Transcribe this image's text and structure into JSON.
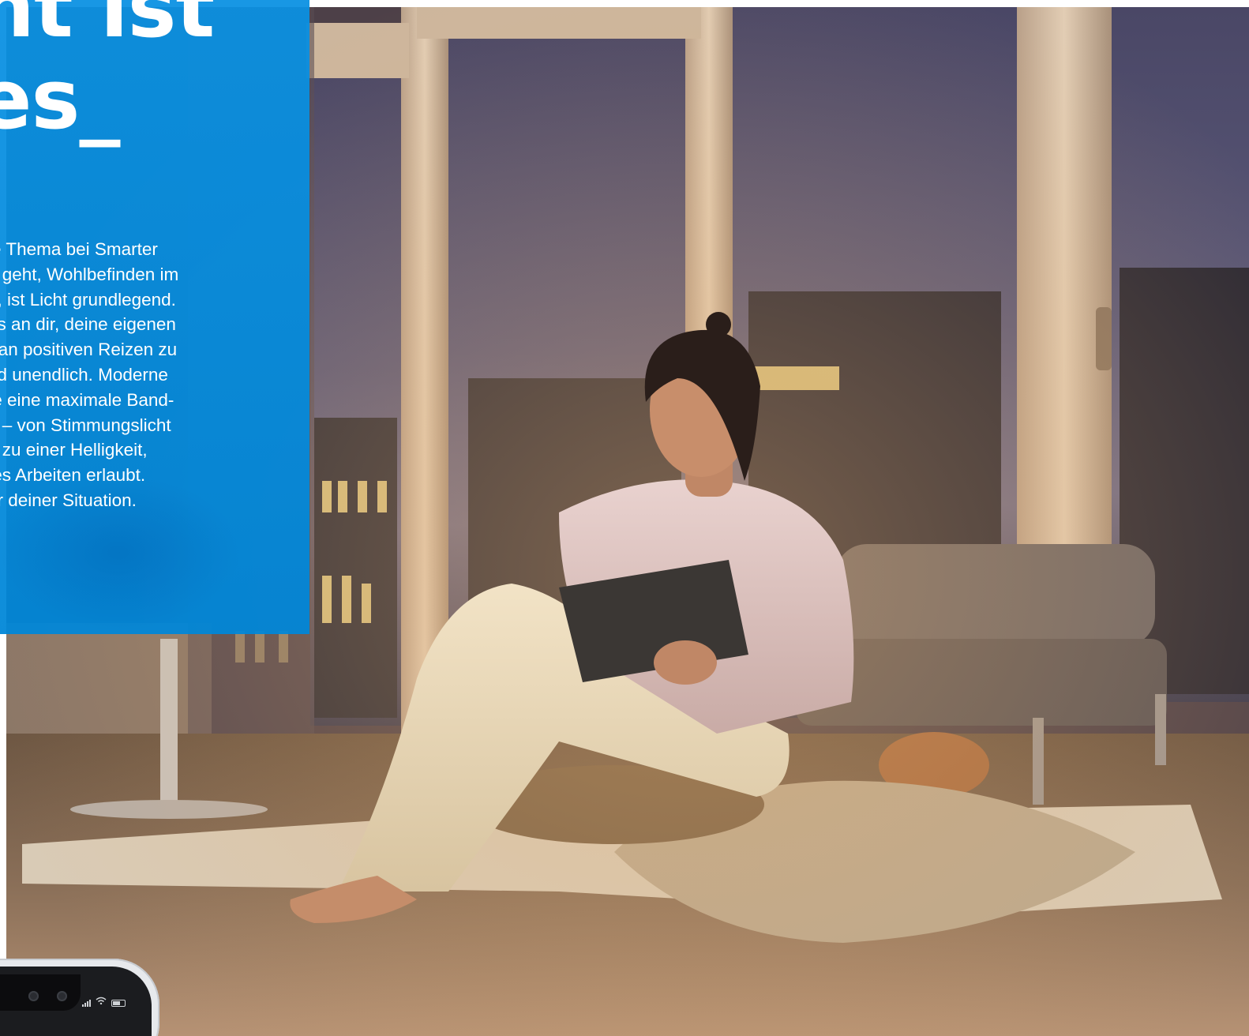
{
  "hero": {
    "headline_lines": [
      "ht ist",
      "es_"
    ],
    "body_lines": [
      "le Thema bei Smarter",
      "n geht, Wohlbefinden im",
      "n, ist Licht grundlegend.",
      "es an dir, deine eigenen",
      "r an positiven Reizen zu",
      "nd unendlich. Moderne",
      "te eine maximale Band-",
      "n – von Stimmungslicht",
      "n zu einer Helligkeit,",
      "tes Arbeiten erlaubt.",
      "er deiner Situation."
    ]
  },
  "colors": {
    "panel_blue": "#008ce1",
    "text_white": "#ffffff",
    "page_background": "#ffffff"
  },
  "phone": {
    "status_icons": [
      "signal-icon",
      "wifi-icon",
      "battery-icon"
    ]
  }
}
